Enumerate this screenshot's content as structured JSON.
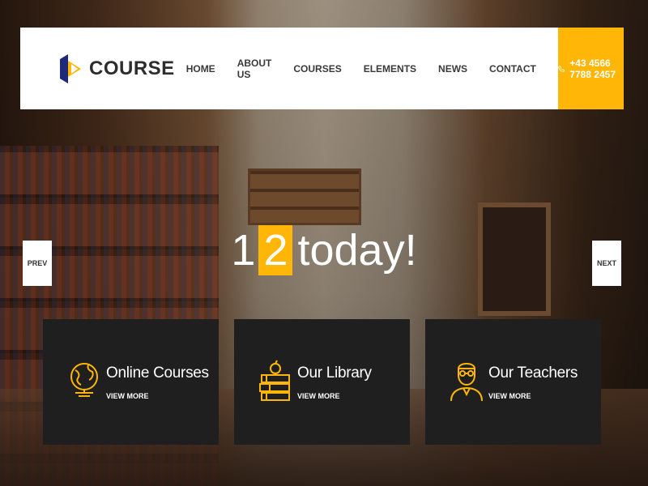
{
  "brand": {
    "name": "COURSE",
    "accent": "#ffb606",
    "logo_colors": [
      "#1e2a78",
      "#ffb606"
    ]
  },
  "nav": {
    "items": [
      "HOME",
      "ABOUT US",
      "COURSES",
      "ELEMENTS",
      "NEWS",
      "CONTACT"
    ]
  },
  "contact": {
    "phone": "+43 4566 7788 2457",
    "icon": "phone-icon"
  },
  "hero": {
    "number_1": "1",
    "number_2": "2",
    "text": "today!"
  },
  "slider": {
    "prev_label": "PREV",
    "next_label": "NEXT"
  },
  "features": [
    {
      "title": "Online Courses",
      "link": "VIEW MORE",
      "icon": "globe-icon"
    },
    {
      "title": "Our Library",
      "link": "VIEW MORE",
      "icon": "books-icon"
    },
    {
      "title": "Our Teachers",
      "link": "VIEW MORE",
      "icon": "teacher-icon"
    }
  ]
}
